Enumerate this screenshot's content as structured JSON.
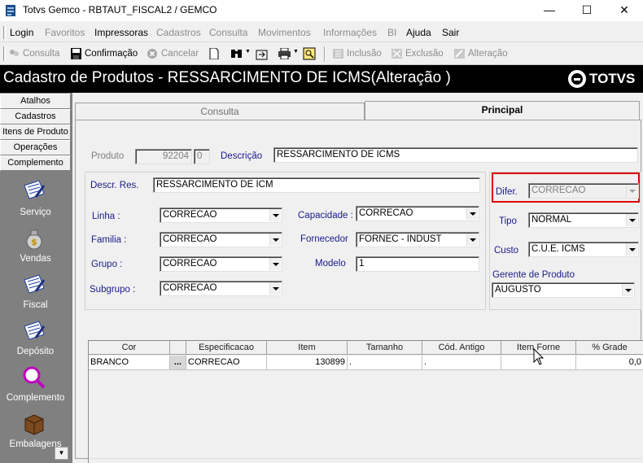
{
  "window": {
    "title": "Totvs Gemco - RBTAUT_FISCAL2 / GEMCO",
    "minimize": "—",
    "maximize": "☐",
    "close": "✕"
  },
  "menu": [
    "Login",
    "Favoritos",
    "Impressoras",
    "Cadastros",
    "Consulta",
    "Movimentos",
    "Informações",
    "BI",
    "Ajuda",
    "Sair"
  ],
  "toolbar": {
    "consulta": "Consulta",
    "confirmacao": "Confirmação",
    "cancelar": "Cancelar",
    "inclusao": "Inclusão",
    "exclusao": "Exclusão",
    "alteracao": "Alteração"
  },
  "header": {
    "title": "Cadastro de Produtos  - RESSARCIMENTO DE ICMS(Alteração )",
    "logo": "TOTVS"
  },
  "leftnav": {
    "buttons": [
      "Atalhos",
      "Cadastros",
      "Itens de Produto",
      "Operações",
      "Complemento"
    ],
    "items": [
      "Serviço",
      "Vendas",
      "Fiscal",
      "Depósito",
      "Complemento",
      "Embalagens"
    ]
  },
  "tabs": {
    "consulta": "Consulta",
    "principal": "Principal"
  },
  "form": {
    "produto_label": "Produto",
    "produto_code": "92204",
    "produto_digit": "0",
    "descricao_label": "Descrição",
    "descricao": "RESSARCIMENTO DE ICMS",
    "descr_res_label": "Descr. Res.",
    "descr_res": "RESSARCIMENTO DE ICM",
    "difer_label": "Difer.",
    "difer": "CORRECAO",
    "linha_label": "Linha :",
    "linha": "CORRECAO",
    "familia_label": "Familia :",
    "familia": "CORRECAO",
    "grupo_label": "Grupo :",
    "grupo": "CORRECAO",
    "subgrupo_label": "Subgrupo :",
    "subgrupo": "CORRECAO",
    "capacidade_label": "Capacidade :",
    "capacidade": "CORRECAO",
    "fornecedor_label": "Fornecedor",
    "fornecedor": "FORNEC - INDUST",
    "modelo_label": "Modelo",
    "modelo": "1",
    "tipo_label": "Tipo",
    "tipo": "NORMAL",
    "custo_label": "Custo",
    "custo": "C.U.E. ICMS",
    "gerente_label": "Gerente de Produto",
    "gerente": "AUGUSTO"
  },
  "grid": {
    "columns": [
      "Cor",
      "",
      "Especificacao",
      "Item",
      "Tamanho",
      "Cód. Antigo",
      "Item Forne",
      "% Grade"
    ],
    "rows": [
      [
        "BRANCO",
        "...",
        "CORRECAO",
        "130899",
        ".",
        ".",
        "",
        "0,0"
      ]
    ]
  },
  "colors": {
    "highlight_border": "#e00000",
    "label_blue": "#1a1a8a",
    "header_bg": "#000000"
  }
}
